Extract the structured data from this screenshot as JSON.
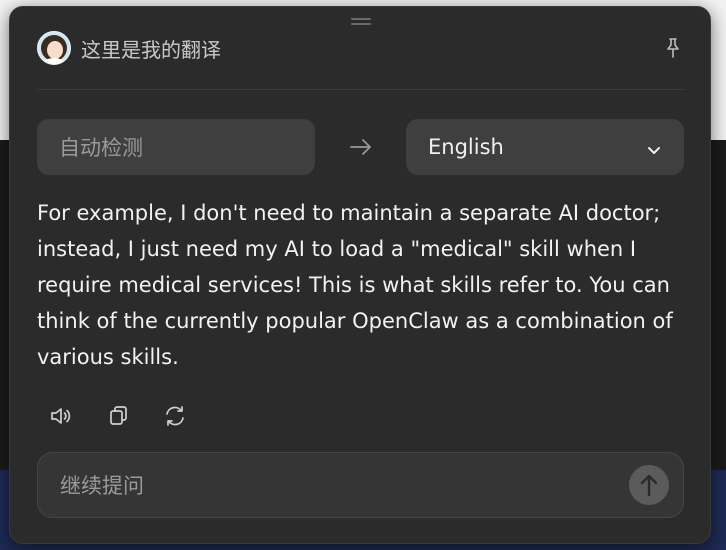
{
  "header": {
    "title": "这里是我的翻译"
  },
  "languages": {
    "source": "自动检测",
    "target": "English"
  },
  "translation": {
    "text": "For example, I don't need to maintain a separate AI doctor; instead, I just need my AI to load a \"medical\" skill when I require medical services! This is what skills refer to. You can think of the currently popular OpenClaw as a combination of various skills."
  },
  "actions": [
    {
      "icon": "speaker-icon"
    },
    {
      "icon": "copy-icon"
    },
    {
      "icon": "refresh-icon"
    }
  ],
  "followup": {
    "placeholder": "继续提问"
  },
  "colors": {
    "panel": "#2b2b2b",
    "box": "#3f3f3f",
    "text": "#f2f2f2",
    "muted": "#9a9a9a"
  }
}
